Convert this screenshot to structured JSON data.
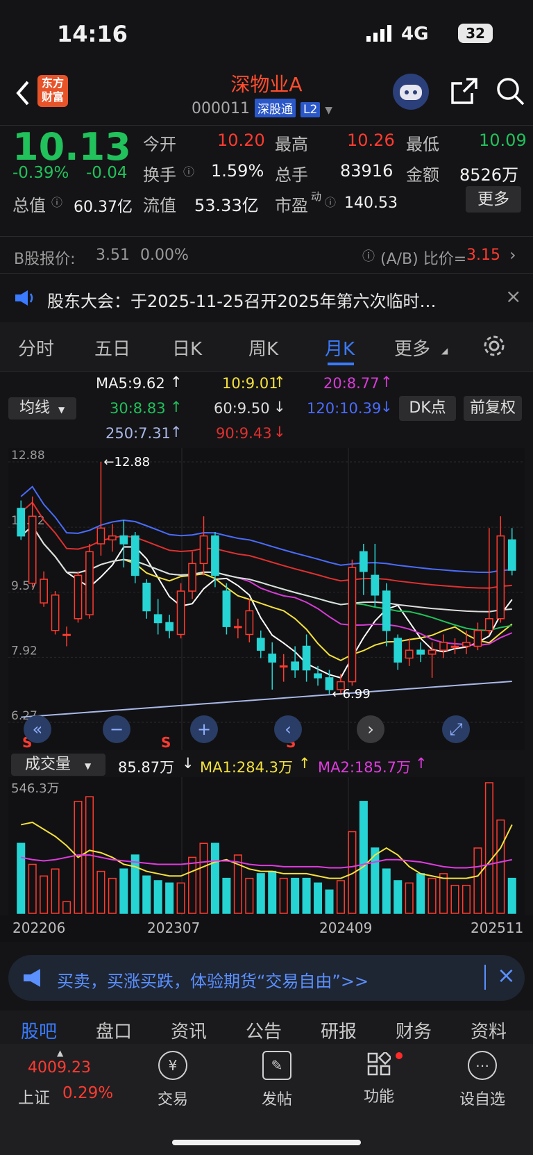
{
  "status_bar": {
    "time": "14:16",
    "network": "4G",
    "battery": "32"
  },
  "header": {
    "title": "深物业A",
    "code": "000011",
    "badge": "深股通",
    "level": "L2",
    "logo_line1": "东方",
    "logo_line2": "财富"
  },
  "quote": {
    "price": "10.13",
    "change_pct": "-0.39%",
    "change": "-0.04",
    "open_label": "今开",
    "open": "10.20",
    "high_label": "最高",
    "high": "10.26",
    "low_label": "最低",
    "low": "10.09",
    "turnover_label": "换手",
    "turnover": "1.59%",
    "volume_label": "总手",
    "volume": "83916",
    "amount_label": "金额",
    "amount": "8526万",
    "mktcap_label": "总值",
    "mktcap": "60.37亿",
    "float_label": "流值",
    "float": "53.33亿",
    "pe_label": "市盈",
    "pe_sup": "动",
    "pe": "140.53",
    "more_button": "更多"
  },
  "bshare": {
    "label": "B股报价:",
    "price": "3.51",
    "pct": "0.00%",
    "ratio_label": "(A/B) 比价=",
    "ratio": "3.15"
  },
  "notice": {
    "text": "股东大会：于2025-11-25召开2025年第六次临时…"
  },
  "tabs": [
    "分时",
    "五日",
    "日K",
    "周K",
    "月K",
    "更多"
  ],
  "active_tab": "月K",
  "ma": {
    "selector": "均线",
    "ma5": "MA5:9.62",
    "ma10": "10:9.01",
    "ma20": "20:8.77",
    "ma30": "30:8.83",
    "ma60": "60:9.50",
    "ma120": "120:10.39",
    "ma250": "250:7.31",
    "ma90": "90:9.43",
    "dk_button": "DK点",
    "adjust_button": "前复权",
    "colors": {
      "ma5": "#ffffff",
      "ma10": "#f5e13c",
      "ma20": "#d83bd8",
      "ma30": "#21c15b",
      "ma60": "#dddddd",
      "ma120": "#4a6cff",
      "ma250": "#a9b8e8",
      "ma90": "#e03030"
    }
  },
  "chart_data": {
    "type": "candlestick",
    "y_ticks": [
      "12.88",
      "11.22",
      "9.57",
      "7.92",
      "6.27"
    ],
    "high_label": "←12.88",
    "low_label": "←6.99",
    "signal_labels": [
      "S",
      "S",
      "S"
    ],
    "candles": [
      {
        "o": 11.7,
        "c": 11.0,
        "h": 11.9,
        "l": 10.9
      },
      {
        "o": 9.8,
        "c": 11.5,
        "h": 12.0,
        "l": 9.7
      },
      {
        "o": 9.3,
        "c": 9.9,
        "h": 10.1,
        "l": 9.2
      },
      {
        "o": 8.6,
        "c": 9.5,
        "h": 9.6,
        "l": 8.5
      },
      {
        "o": 8.5,
        "c": 8.5,
        "h": 8.7,
        "l": 8.2
      },
      {
        "o": 8.9,
        "c": 10.0,
        "h": 10.1,
        "l": 8.8
      },
      {
        "o": 9.0,
        "c": 10.6,
        "h": 10.8,
        "l": 8.9
      },
      {
        "o": 10.8,
        "c": 11.2,
        "h": 12.88,
        "l": 10.5
      },
      {
        "o": 10.9,
        "c": 11.0,
        "h": 11.3,
        "l": 10.6
      },
      {
        "o": 11.0,
        "c": 10.8,
        "h": 11.4,
        "l": 10.2
      },
      {
        "o": 11.0,
        "c": 10.0,
        "h": 11.1,
        "l": 9.8
      },
      {
        "o": 9.8,
        "c": 9.1,
        "h": 9.9,
        "l": 8.9
      },
      {
        "o": 9.0,
        "c": 8.8,
        "h": 9.4,
        "l": 8.5
      },
      {
        "o": 8.8,
        "c": 8.6,
        "h": 9.0,
        "l": 8.4
      },
      {
        "o": 8.5,
        "c": 9.6,
        "h": 9.8,
        "l": 8.4
      },
      {
        "o": 9.6,
        "c": 10.3,
        "h": 10.6,
        "l": 9.4
      },
      {
        "o": 10.3,
        "c": 11.0,
        "h": 11.5,
        "l": 10.0
      },
      {
        "o": 11.0,
        "c": 10.0,
        "h": 11.1,
        "l": 9.7
      },
      {
        "o": 9.6,
        "c": 8.7,
        "h": 9.8,
        "l": 8.5
      },
      {
        "o": 8.7,
        "c": 8.7,
        "h": 8.9,
        "l": 8.4
      },
      {
        "o": 8.5,
        "c": 9.1,
        "h": 9.4,
        "l": 8.3
      },
      {
        "o": 8.4,
        "c": 8.1,
        "h": 8.6,
        "l": 7.9
      },
      {
        "o": 8.0,
        "c": 7.8,
        "h": 8.3,
        "l": 7.1
      },
      {
        "o": 7.7,
        "c": 7.7,
        "h": 8.0,
        "l": 7.3
      },
      {
        "o": 7.8,
        "c": 7.6,
        "h": 8.2,
        "l": 7.4
      },
      {
        "o": 8.2,
        "c": 7.6,
        "h": 8.5,
        "l": 7.3
      },
      {
        "o": 7.5,
        "c": 7.4,
        "h": 7.7,
        "l": 7.2
      },
      {
        "o": 7.4,
        "c": 7.1,
        "h": 7.6,
        "l": 6.99
      },
      {
        "o": 7.1,
        "c": 7.3,
        "h": 7.5,
        "l": 7.0
      },
      {
        "o": 7.3,
        "c": 10.2,
        "h": 10.4,
        "l": 7.2
      },
      {
        "o": 10.6,
        "c": 10.1,
        "h": 10.8,
        "l": 9.5
      },
      {
        "o": 10.0,
        "c": 9.5,
        "h": 10.8,
        "l": 9.2
      },
      {
        "o": 9.6,
        "c": 8.6,
        "h": 9.8,
        "l": 8.2
      },
      {
        "o": 8.4,
        "c": 7.8,
        "h": 8.5,
        "l": 7.6
      },
      {
        "o": 7.9,
        "c": 8.1,
        "h": 8.4,
        "l": 7.7
      },
      {
        "o": 8.1,
        "c": 8.0,
        "h": 8.3,
        "l": 7.8
      },
      {
        "o": 8.0,
        "c": 8.1,
        "h": 8.3,
        "l": 7.4
      },
      {
        "o": 8.1,
        "c": 8.3,
        "h": 8.5,
        "l": 7.9
      },
      {
        "o": 8.2,
        "c": 8.2,
        "h": 8.4,
        "l": 8.0
      },
      {
        "o": 8.2,
        "c": 8.3,
        "h": 8.6,
        "l": 8.0
      },
      {
        "o": 8.2,
        "c": 8.6,
        "h": 8.8,
        "l": 8.1
      },
      {
        "o": 8.6,
        "c": 8.9,
        "h": 11.2,
        "l": 8.5
      },
      {
        "o": 8.9,
        "c": 11.0,
        "h": 11.5,
        "l": 8.8
      },
      {
        "o": 10.9,
        "c": 10.13,
        "h": 11.2,
        "l": 10.0
      }
    ]
  },
  "volume": {
    "selector": "成交量",
    "value": "85.87万",
    "ma1": "MA1:284.3万",
    "ma2": "MA2:185.7万",
    "y_max_label": "546.3万",
    "x_labels": [
      "202206",
      "202307",
      "202409",
      "202511"
    ],
    "bars": [
      300,
      210,
      160,
      190,
      50,
      480,
      500,
      180,
      150,
      190,
      250,
      160,
      140,
      130,
      130,
      240,
      300,
      300,
      150,
      250,
      150,
      170,
      180,
      150,
      150,
      150,
      130,
      100,
      140,
      350,
      480,
      280,
      190,
      140,
      130,
      170,
      150,
      170,
      120,
      120,
      280,
      560,
      400,
      150
    ],
    "ma1_line": [
      380,
      390,
      360,
      330,
      290,
      240,
      270,
      260,
      240,
      210,
      200,
      180,
      170,
      160,
      160,
      180,
      200,
      220,
      230,
      210,
      190,
      180,
      180,
      170,
      170,
      170,
      160,
      150,
      150,
      170,
      200,
      250,
      280,
      250,
      200,
      170,
      160,
      150,
      150,
      150,
      160,
      220,
      280,
      380
    ],
    "ma2_line": [
      240,
      230,
      225,
      230,
      240,
      250,
      250,
      240,
      230,
      225,
      220,
      215,
      210,
      210,
      210,
      215,
      220,
      225,
      225,
      220,
      210,
      205,
      205,
      200,
      200,
      200,
      200,
      195,
      195,
      200,
      210,
      220,
      230,
      230,
      225,
      220,
      210,
      200,
      195,
      195,
      200,
      210,
      220,
      230
    ]
  },
  "banner": {
    "text": "买卖，买涨买跌，体验期货“交易自由”>>"
  },
  "bottom_tabs": [
    "股吧",
    "盘口",
    "资讯",
    "公告",
    "研报",
    "财务",
    "资料"
  ],
  "active_bottom_tab": "股吧",
  "nav": {
    "index_value": "4009.23",
    "index_name": "上证",
    "index_pct": "0.29%",
    "items": [
      "交易",
      "发帖",
      "功能",
      "设自选"
    ]
  }
}
